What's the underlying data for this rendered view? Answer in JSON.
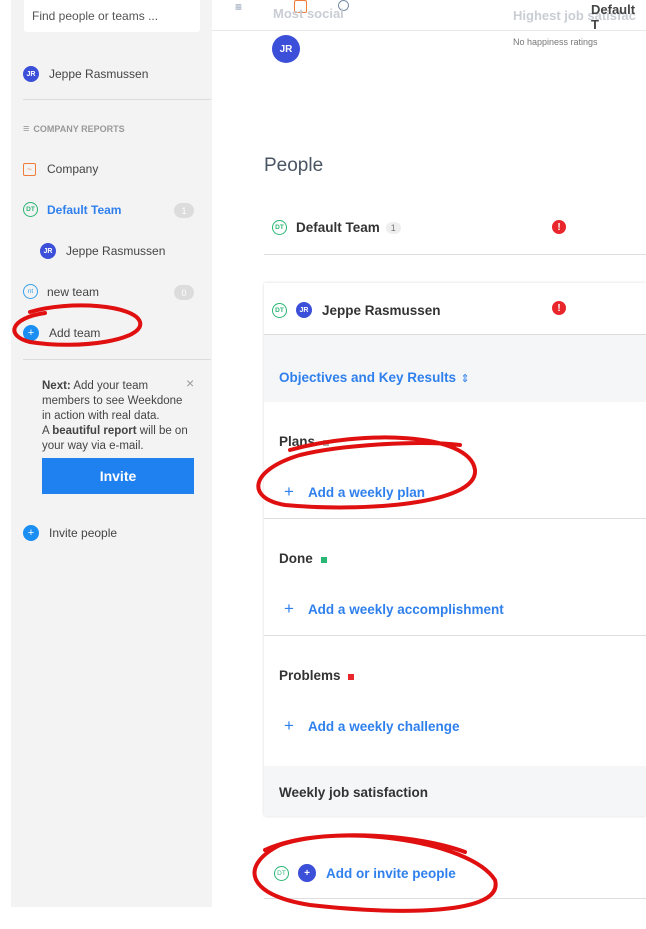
{
  "sidebar": {
    "search_placeholder": "Find people or teams ...",
    "user": {
      "initials": "JR",
      "name": "Jeppe Rasmussen"
    },
    "section_header": "COMPANY REPORTS",
    "company_label": "Company",
    "teams": [
      {
        "initials": "DT",
        "name": "Default Team",
        "count": "1",
        "member": {
          "initials": "JR",
          "name": "Jeppe Rasmussen"
        }
      },
      {
        "initials": "nt",
        "name": "new team",
        "count": "0"
      }
    ],
    "add_team_label": "Add team",
    "next_box": {
      "lead": "Next:",
      "text1": " Add your team members to see Weekdone in action with real data.",
      "text2a": "A ",
      "bold": "beautiful report",
      "text2b": " will be on your way via e-mail.",
      "button": "Invite"
    },
    "invite_people_label": "Invite people"
  },
  "topbar": {
    "most_social": "Most social",
    "avatar_initials": "JR",
    "highest_job": "Highest job satisfac",
    "no_ratings": "No happiness ratings",
    "default_team_cut": "Default T"
  },
  "main": {
    "heading": "People",
    "team_row": {
      "initials": "DT",
      "name": "Default Team",
      "count": "1"
    },
    "person_row": {
      "team_initials": "DT",
      "initials": "JR",
      "name": "Jeppe Rasmussen"
    },
    "okr_label": "Objectives and Key Results",
    "sections": [
      {
        "title": "Plans",
        "add": "Add a weekly plan",
        "color": "#b0b0b0"
      },
      {
        "title": "Done",
        "add": "Add a weekly accomplishment",
        "color": "#2bb673"
      },
      {
        "title": "Problems",
        "add": "Add a weekly challenge",
        "color": "#e8262c"
      }
    ],
    "job_satisfaction": "Weekly job satisfaction",
    "add_invite": {
      "team_initials": "DT",
      "label": "Add or invite people"
    }
  }
}
